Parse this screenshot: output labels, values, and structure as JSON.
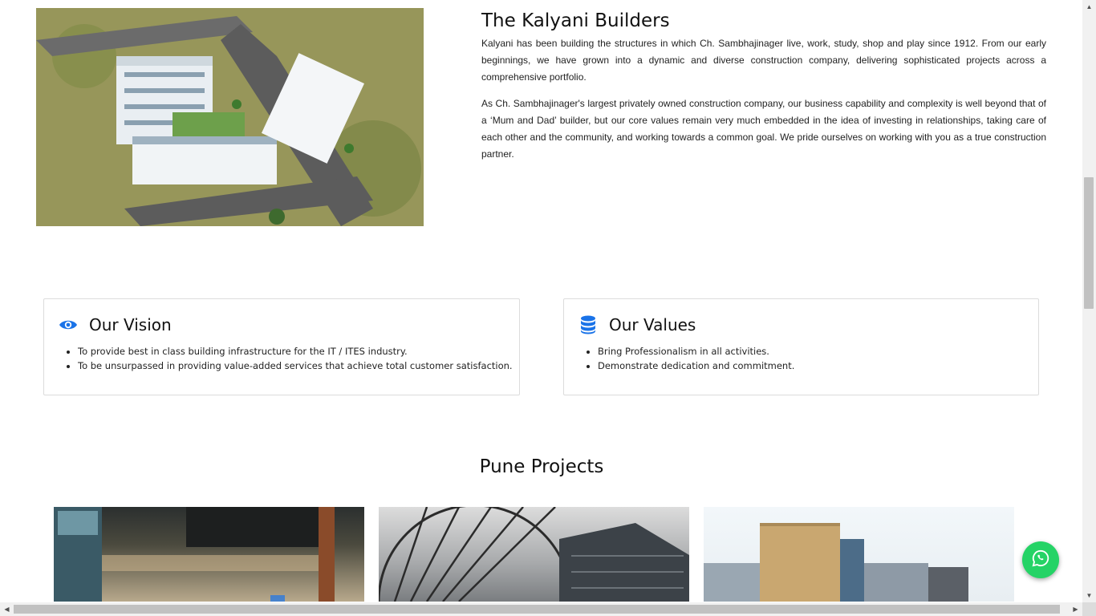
{
  "about": {
    "image_alt": "Aerial rendering of Kalyani Builders residential project",
    "title": "The Kalyani Builders",
    "paragraph1": "Kalyani has been building the structures in which Ch. Sambhajinager live, work, study, shop and play since 1912. From our early beginnings, we have grown into a dynamic and diverse construction company, delivering sophisticated projects across a comprehensive portfolio.",
    "paragraph2": "As Ch. Sambhajinager's largest privately owned construction company, our business capability and complexity is well beyond that of a ‘Mum and Dad’ builder, but our core values remain very much embedded in the idea of investing in relationships, taking care of each other and the community, and working towards a common goal. We pride ourselves on working with you as a true construction partner."
  },
  "vision": {
    "icon": "eye-icon",
    "title": "Our Vision",
    "items": [
      "To provide best in class building infrastructure for the IT / ITES industry.",
      "To be unsurpassed in providing value-added services that achieve total customer satisfaction."
    ]
  },
  "values": {
    "icon": "database-icon",
    "title": "Our Values",
    "items": [
      "Bring Professionalism in all activities.",
      "Demonstrate dedication and commitment."
    ]
  },
  "projects": {
    "title": "Pune Projects"
  },
  "whatsapp": {
    "icon": "whatsapp-icon",
    "color": "#25d366"
  },
  "colors": {
    "accent_blue": "#1a73e8"
  },
  "scrollbars": {
    "vertical": {
      "up_glyph": "▲",
      "down_glyph": "▼"
    },
    "horizontal": {
      "left_glyph": "◀",
      "right_glyph": "▶"
    }
  }
}
